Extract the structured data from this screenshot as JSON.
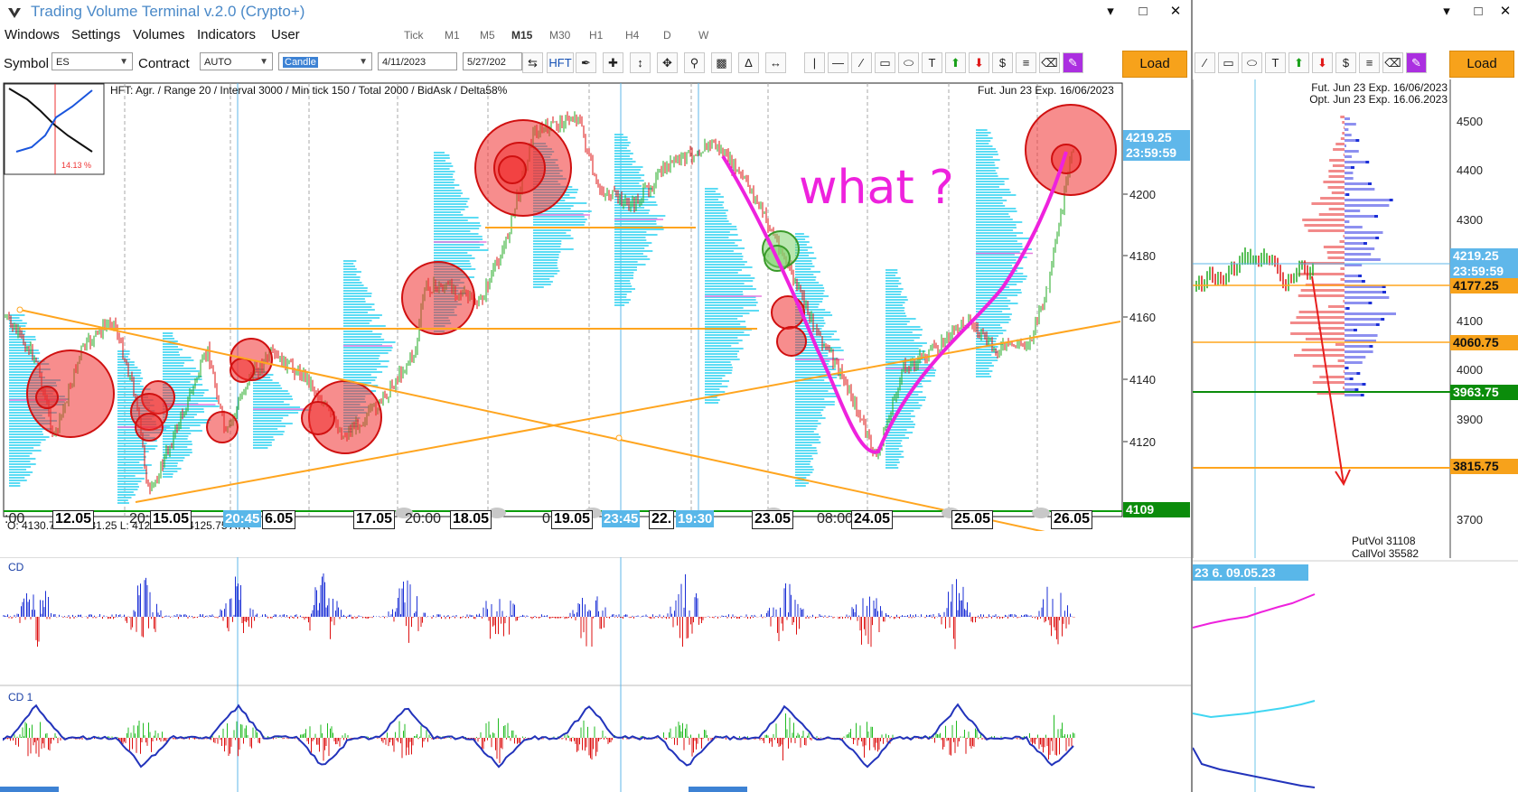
{
  "app": {
    "title": "Trading Volume Terminal v.2.0 (Crypto+)",
    "window_buttons": [
      "▾",
      "□",
      "✕"
    ]
  },
  "menu": [
    "Windows",
    "Settings",
    "Volumes",
    "Indicators",
    "User"
  ],
  "timeframes": [
    "Tick",
    "M1",
    "M5",
    "M15",
    "M30",
    "H1",
    "H4",
    "D",
    "W"
  ],
  "active_timeframe": "M15",
  "toolbar": {
    "symbol_label": "Symbol",
    "symbol_value": "ES",
    "contract_label": "Contract",
    "contract_value": "AUTO",
    "chart_type": "Candle",
    "date_from": "4/11/2023",
    "date_to": "5/27/202",
    "hft_label": "HFT",
    "load_label": "Load"
  },
  "main_chart": {
    "info_line": "HFT: Agr. / Range 20 / Interval 3000 / Min tick 150 / Total 2000 / BidAsk / Delta58%",
    "expiry": "Fut. Jun 23 Exp. 16/06/2023",
    "thumb_percent": "14.13 %",
    "annotation": "what ?",
    "ohlc": "O: 4130.75   H: 4131.25   L: 4122.75   C: 4125.75   ATR = 202",
    "price_axis": [
      "4200",
      "4180",
      "4160",
      "4140",
      "4120"
    ],
    "price_tag_price": "4219.25",
    "price_tag_time": "23:59:59",
    "price_tag_low": "4109",
    "dates": [
      "12.05",
      "15.05",
      "6.05",
      "17.05",
      "18.05",
      "19.05",
      "22.",
      "23.05",
      "24.05",
      "25.05",
      "26.05"
    ],
    "time_labels": [
      "20:45",
      "23:45",
      "19:30"
    ],
    "time_texts": [
      ":00",
      "20:",
      "20:00",
      "0",
      "08:00"
    ],
    "colors": {
      "up": "#22aa22",
      "down": "#dd1111",
      "profile": "#3fd6f2",
      "circle": "#f03030",
      "trend": "#ffa51f",
      "pen": "#ee22dd"
    }
  },
  "cd_panel": {
    "label": "CD"
  },
  "cd1_panel": {
    "label": "CD 1"
  },
  "side_chart": {
    "expiry_fut": "Fut. Jun 23 Exp. 16/06/2023",
    "expiry_opt": "Opt. Jun 23 Exp. 16.06.2023",
    "price_axis": [
      "4500",
      "4400",
      "4300",
      "4200",
      "4100",
      "4000",
      "3900",
      "3800",
      "3700"
    ],
    "price_tag_price": "4219.25",
    "price_tag_time": "23:59:59",
    "level_tags": [
      "4177.25",
      "4060.75",
      "3963.75",
      "3815.75"
    ],
    "put_vol": "PutVol  31108",
    "call_vol": "CallVol  35582",
    "date_strip": "23 6. 09.05.23"
  }
}
